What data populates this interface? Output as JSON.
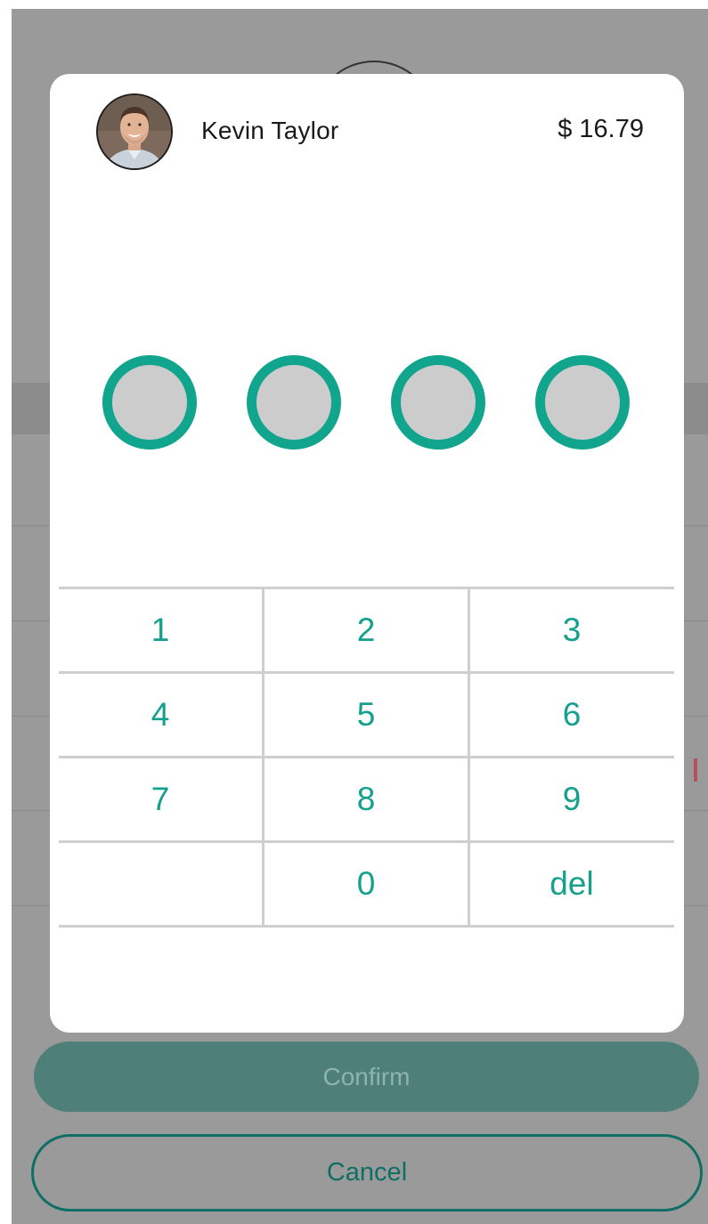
{
  "payee": {
    "name": "Kevin Taylor",
    "amount": "$ 16.79"
  },
  "pin": {
    "length": 4,
    "entered": 0
  },
  "keypad": {
    "keys": [
      "1",
      "2",
      "3",
      "4",
      "5",
      "6",
      "7",
      "8",
      "9",
      "",
      "0",
      "del"
    ]
  },
  "actions": {
    "confirm_label": "Confirm",
    "cancel_label": "Cancel"
  },
  "colors": {
    "accent": "#11a58e",
    "confirm_bg": "#4e7f78",
    "cancel_border": "#0f6f64",
    "pin_fill": "#cccccc"
  },
  "icons": {
    "avatar": "user-avatar-photo"
  }
}
